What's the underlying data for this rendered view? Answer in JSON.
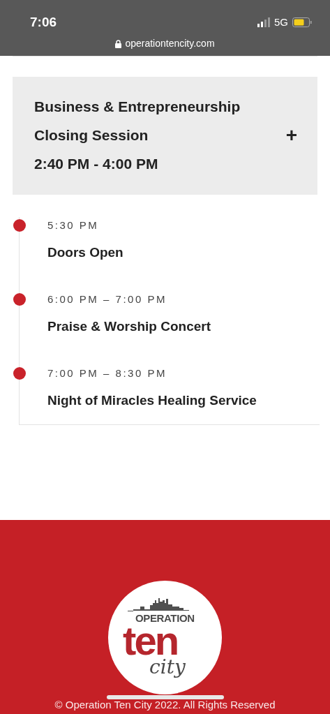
{
  "status_bar": {
    "time": "7:06",
    "network": "5G",
    "url": "operationtencity.com"
  },
  "session": {
    "title_lines": [
      "Business & Entrepreneurship",
      "Closing Session"
    ],
    "time": "2:40 PM - 4:00 PM",
    "toggle": "+",
    "expanded": false
  },
  "timeline": [
    {
      "time": "5:30 PM",
      "title": "Doors Open",
      "color": "#c9222a"
    },
    {
      "time": "6:00 PM – 7:00 PM",
      "title": "Praise & Worship Concert",
      "color": "#c9222a"
    },
    {
      "time": "7:00 PM – 8:30 PM",
      "title": "Night of Miracles Healing Service",
      "color": "#c9222a"
    }
  ],
  "footer": {
    "logo": {
      "top": "OPERATION",
      "main": "ten",
      "script": "city"
    },
    "copyright": "© Operation Ten City 2022. All Rights Reserved"
  }
}
